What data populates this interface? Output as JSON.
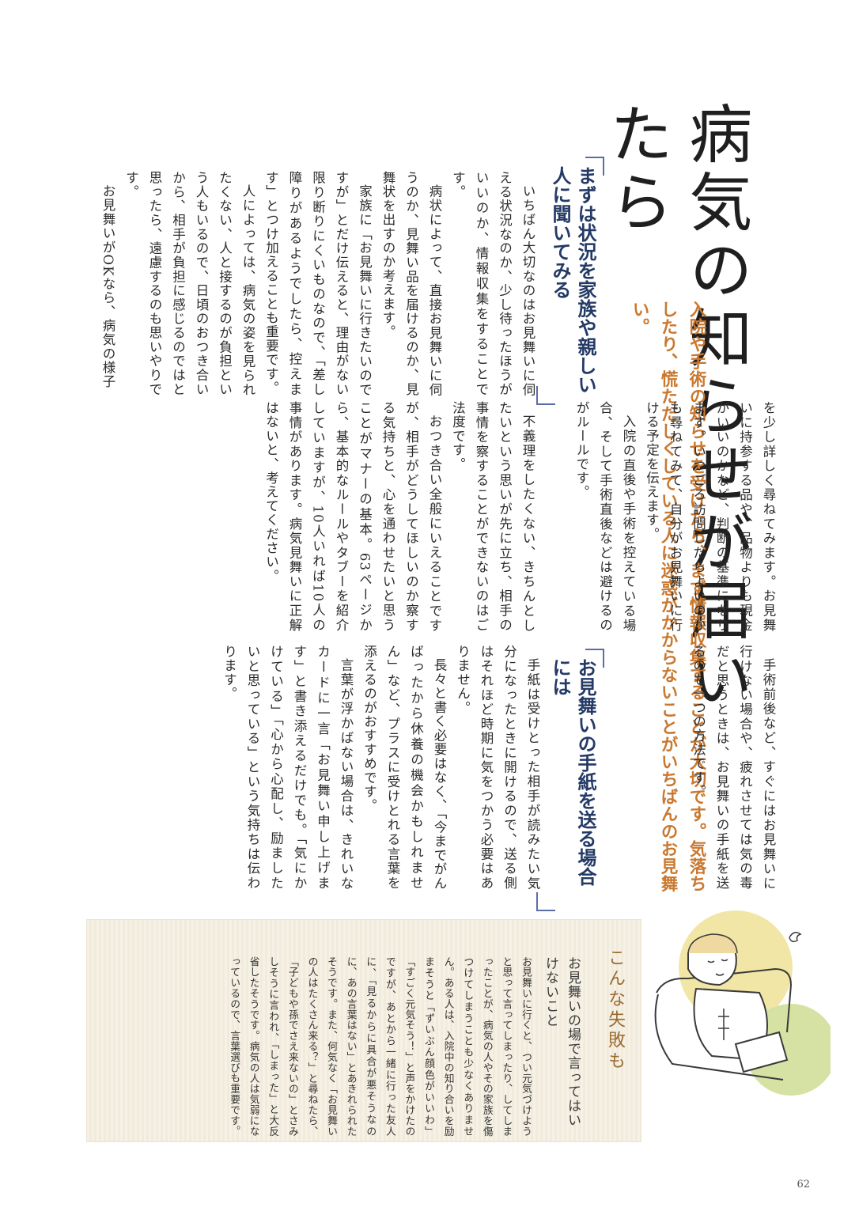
{
  "title": "病気の知らせが届いたら",
  "lead": "入院や手術の知らせを受けたら、まず情報収集することが大切です。気落ちしたり、慌ただしくしている人に迷惑がかからないことがいちばんのお見舞い。",
  "section1": {
    "heading": "まずは状況を家族や親しい人に聞いてみる",
    "paragraphs": [
      "いちばん大切なのはお見舞いに伺える状況なのか、少し待ったほうがいいのか、情報収集をすることです。",
      "病状によって、直接お見舞いに伺うのか、見舞い品を届けるのか、見舞状を出すのか考えます。",
      "家族に「お見舞いに行きたいのですが」とだけ伝えると、理由がない限り断りにくいものなので、「差し障りがあるようでしたら、控えます」とつけ加えることも重要です。",
      "人によっては、病気の姿を見られたくない、人と接するのが負担という人もいるので、日頃のおつき合いから、相手が負担に感じるのではと思ったら、遠慮するのも思いやりです。",
      "お見舞いがOKなら、病気の様子"
    ],
    "continuation": [
      "を少し詳しく尋ねてみます。お見舞いに持参する品や、品物よりも現金がいいのかなど、判断の基準になります。いつごろ訪問したらよいのかも尋ねてみて、自分がお見舞いに行ける予定を伝えます。",
      "入院の直後や手術を控えている場合、そして手術直後などは避けるのがルールです。",
      "不義理をしたくない、きちんとしたいという思いが先に立ち、相手の事情を察することができないのはご法度です。",
      "おつき合い全般にいえることですが、相手がどうしてほしいのか察する気持ちと、心を通わせたいと思うことがマナーの基本。63ページから、基本的なルールやタブーを紹介していますが、10人いれば10人の事情があります。病気見舞いに正解はないと、考えてください。"
    ]
  },
  "section2": {
    "heading": "お見舞いの手紙を送る場合には",
    "paragraphs": [
      "手術前後など、すぐにはお見舞いに行けない場合や、疲れさせては気の毒だと思うときは、お見舞いの手紙を送るのも一つの方法です。",
      "手紙は受けとった相手が読みたい気分になったときに開けるので、送る側はそれほど時期に気をつかう必要はありません。",
      "長々と書く必要はなく、「今までがんばったから休養の機会かもしれません」など、プラスに受けとれる言葉を添えるのがおすすめです。",
      "言葉が浮かばない場合は、きれいなカードに一言「お見舞い申し上げます」と書き添えるだけでも。「気にかけている」「心から心配し、励ましたいと思っている」という気持ちは伝わります。"
    ]
  },
  "sidebox": {
    "heading": "こんな失敗も",
    "subheading": "お見舞いの場で言ってはいけないこと",
    "text": "お見舞いに行くと、つい元気づけようと思って言ってしまったり、してしまったことが、病気の人やその家族を傷つけてしまうことも少なくありません。ある人は、入院中の知り合いを励まそうと「ずいぶん顔色がいいわ」「すごく元気そう！」と声をかけたのですが、あとから一緒に行った友人に、「見るからに具合が悪そうなのに、あの言葉はない」とあきれられたそうです。また、何気なく「お見舞いの人はたくさん来る？」と尋ねたら、「子どもや孫でさえ来ないの」とさみしそうに言われ、「しまった」と大反省したそうです。病気の人は気弱になっているので、言葉選びも重要です。"
  },
  "page_number": "62",
  "colors": {
    "accent_orange": "#c9782f",
    "heading_navy": "#243a66",
    "circle_yellow": "#f2e6a6",
    "circle_green": "#d5e2a4"
  }
}
